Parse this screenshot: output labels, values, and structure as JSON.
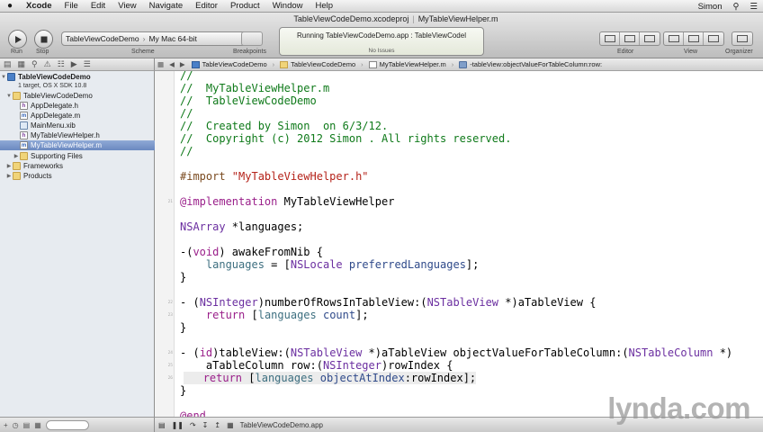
{
  "menubar": {
    "app": "Xcode",
    "items": [
      "File",
      "Edit",
      "View",
      "Navigate",
      "Editor",
      "Product",
      "Window",
      "Help"
    ],
    "user": "Simon"
  },
  "window": {
    "title_project": "TableViewCodeDemo.xcodeproj",
    "title_file": "MyTableViewHelper.m"
  },
  "toolbar": {
    "run_label": "Run",
    "stop_label": "Stop",
    "scheme_label": "Scheme",
    "breakpoints_label": "Breakpoints",
    "editor_label": "Editor",
    "view_label": "View",
    "organizer_label": "Organizer",
    "scheme_target": "TableViewCodeDemo",
    "scheme_destination": "My Mac 64-bit",
    "activity_status": "Running TableViewCodeDemo.app : TableViewCodel",
    "activity_issues": "No Issues"
  },
  "navigator": {
    "project": "TableViewCodeDemo",
    "project_sub": "1 target, OS X SDK 10.8",
    "items": [
      {
        "label": "TableViewCodeDemo",
        "kind": "folder"
      },
      {
        "label": "AppDelegate.h",
        "kind": "h"
      },
      {
        "label": "AppDelegate.m",
        "kind": "m"
      },
      {
        "label": "MainMenu.xib",
        "kind": "xib"
      },
      {
        "label": "MyTableViewHelper.h",
        "kind": "h"
      },
      {
        "label": "MyTableViewHelper.m",
        "kind": "m"
      },
      {
        "label": "Supporting Files",
        "kind": "folder"
      },
      {
        "label": "Frameworks",
        "kind": "folder"
      },
      {
        "label": "Products",
        "kind": "folder"
      }
    ]
  },
  "jumpbar": {
    "crumbs": [
      "TableViewCodeDemo",
      "TableViewCodeDemo",
      "MyTableViewHelper.m",
      "-tableView:objectValueForTableColumn:row:"
    ]
  },
  "editor": {
    "line_numbers": [
      "21",
      "22",
      "23",
      "24",
      "25",
      "26"
    ]
  },
  "debugbar": {
    "target": "TableViewCodeDemo.app"
  },
  "watermark": {
    "text": "lynda.com"
  }
}
